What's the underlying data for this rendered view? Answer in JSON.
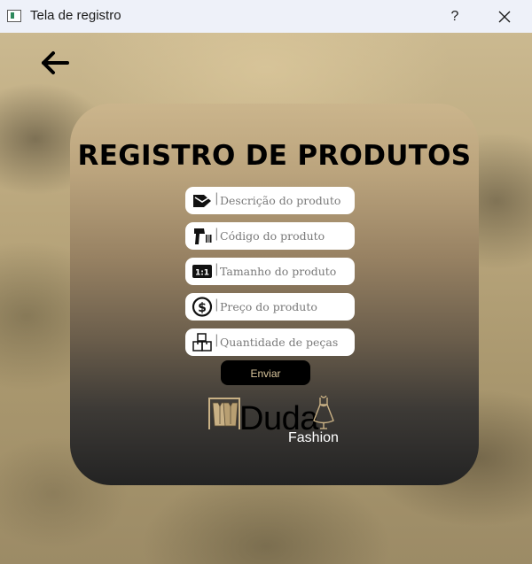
{
  "window": {
    "title": "Tela de registro",
    "help_label": "?"
  },
  "header": {
    "back_icon": "arrow-left-icon"
  },
  "form": {
    "title": "REGISTRO DE PRODUTOS",
    "fields": [
      {
        "icon": "tag-icon",
        "separator": "|",
        "placeholder": "Descrição do produto",
        "value": ""
      },
      {
        "icon": "barcode-scanner-icon",
        "separator": "|",
        "placeholder": "Código do produto",
        "value": ""
      },
      {
        "icon": "ratio-icon",
        "separator": "|",
        "placeholder": "Tamanho do produto",
        "value": ""
      },
      {
        "icon": "dollar-coin-icon",
        "separator": "|",
        "placeholder": "Preço do produto",
        "value": ""
      },
      {
        "icon": "boxes-icon",
        "separator": "|",
        "placeholder": "Quantidade de peças",
        "value": ""
      }
    ],
    "submit_label": "Enviar"
  },
  "logo": {
    "name": "Duda",
    "subtitle": "Fashion"
  },
  "colors": {
    "titlebar": "#eef1f9",
    "card_top": "#cbb58c",
    "card_bottom": "#232323",
    "button_bg": "#000000",
    "button_text": "#d9c59c",
    "logo_accent": "#c9b185"
  }
}
